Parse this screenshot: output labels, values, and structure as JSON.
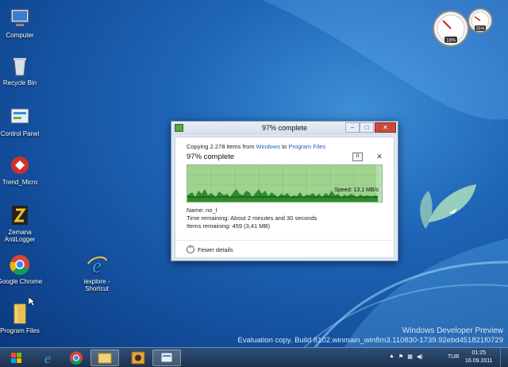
{
  "desktop": {
    "icons": [
      {
        "label": "Computer"
      },
      {
        "label": "Recycle Bin"
      },
      {
        "label": "Control Panel"
      },
      {
        "label": "Trend_Micro"
      },
      {
        "label": "Zemana AntiLogger"
      },
      {
        "label": "Google Chrome"
      },
      {
        "label": "iexplore - Shortcut"
      },
      {
        "label": "Program Files"
      }
    ]
  },
  "gadget": {
    "cpu": "18%",
    "ram": "25%"
  },
  "dialog": {
    "title": "97% complete",
    "copy_prefix": "Copying 2.278 items from ",
    "source": "Windows",
    "copy_mid": " to ",
    "destination": "Program Files",
    "progress_label": "97% complete",
    "progress": 0.97,
    "speed": "Speed: 13,1 MB/s",
    "name_line": "Name: no_l",
    "time_line": "Time remaining: About 2 minutes and 30 seconds",
    "items_line": "Items remaining: 459 (3,41 MB)",
    "fewer_details": "Fewer details",
    "min_glyph": "–",
    "max_glyph": "□",
    "close_glyph": "✕",
    "pause_glyph": "II",
    "stop_glyph": "✕",
    "chevron_glyph": "⌃"
  },
  "watermark": {
    "line1": "Windows Developer Preview",
    "line2": "Evaluation copy. Build 8102.winmain_win8m3.110830-1739.92ebd451821f0729"
  },
  "taskbar": {
    "language": "TUR",
    "time": "01:25",
    "date": "16.09.2011"
  }
}
